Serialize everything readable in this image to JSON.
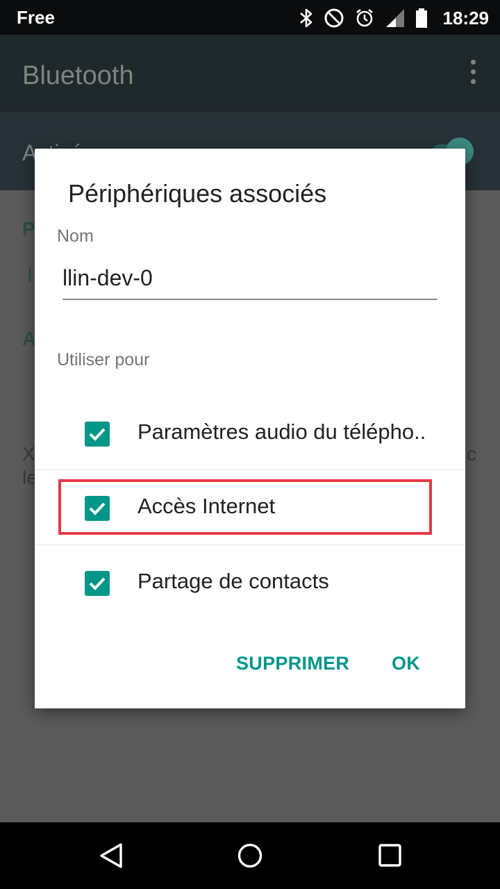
{
  "status_bar": {
    "carrier": "Free",
    "time": "18:29",
    "icons": [
      "bluetooth-icon",
      "do-not-disturb-icon",
      "alarm-icon",
      "signal-icon",
      "battery-icon"
    ]
  },
  "background_app": {
    "title": "Bluetooth",
    "toggle_label": "Activé",
    "toggle_on": true,
    "fragments": [
      "P",
      "l",
      "A",
      "X",
      "le",
      "c"
    ]
  },
  "dialog": {
    "title": "Périphériques associés",
    "name_label": "Nom",
    "name_value": "llin-dev-0",
    "use_for_label": "Utiliser pour",
    "options": [
      {
        "label": "Paramètres audio du télépho..",
        "checked": true
      },
      {
        "label": "Accès Internet",
        "checked": true
      },
      {
        "label": "Partage de contacts",
        "checked": true
      }
    ],
    "buttons": {
      "delete": "SUPPRIMER",
      "ok": "OK"
    },
    "accent_color": "#009688",
    "highlight_color": "#e53945"
  },
  "nav_bar": {
    "buttons": [
      "back-icon",
      "home-icon",
      "recents-icon"
    ]
  }
}
